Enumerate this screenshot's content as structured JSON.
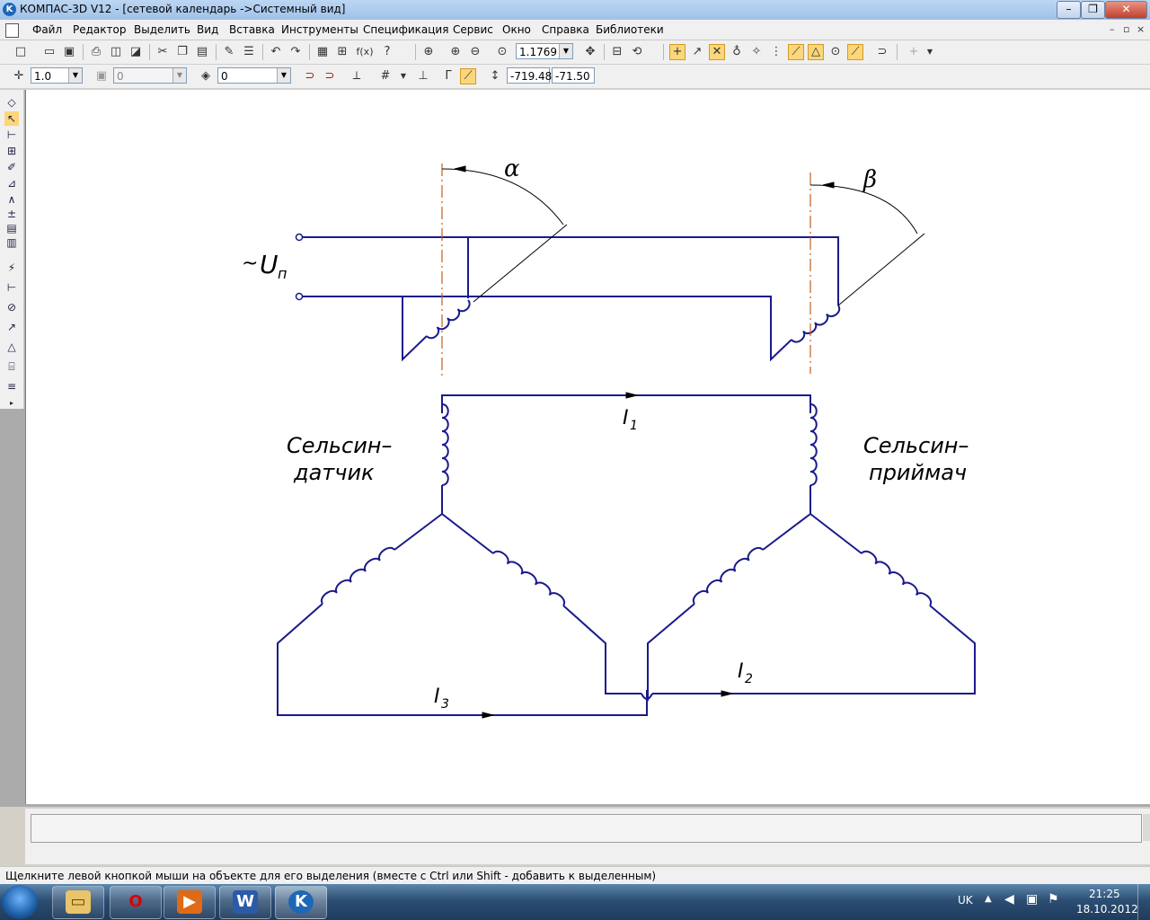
{
  "window": {
    "title": "КОМПАС-3D V12 - [сетевой календарь ->Системный вид]",
    "app_icon": "K",
    "minimize": "–",
    "restore": "❐",
    "close": "✕"
  },
  "menu": {
    "items": [
      "Файл",
      "Редактор",
      "Выделить",
      "Вид",
      "Вставка",
      "Инструменты",
      "Спецификация",
      "Сервис",
      "Окно",
      "Справка",
      "Библиотеки"
    ],
    "mdi_minimize": "–",
    "mdi_restore": "▫",
    "mdi_close": "×"
  },
  "toolbar1": {
    "zoom_value": "1.1769"
  },
  "toolbar2": {
    "step_value": "1.0",
    "layer_value": "0",
    "style_value": "0",
    "coord_x": "-719.48",
    "coord_y": "-71.50"
  },
  "drawing": {
    "line_color": "#1a1a8c",
    "axis_color": "#c06020",
    "alpha_label": "α",
    "beta_label": "β",
    "voltage_tilde": "~",
    "voltage_main": "U",
    "voltage_sub": "п",
    "sender_line1": "Сельсин–",
    "sender_line2": "датчик",
    "receiver_line1": "Сельсин–",
    "receiver_line2": "приймач",
    "i1_main": "I",
    "i1_sub": "1",
    "i2_main": "I",
    "i2_sub": "2",
    "i3_main": "I",
    "i3_sub": "3"
  },
  "status": {
    "message": "Щелкните левой кнопкой мыши на объекте для его выделения (вместе с Ctrl или Shift - добавить к выделенным)"
  },
  "taskbar": {
    "language": "UK",
    "time": "21:25",
    "date": "18.10.2012",
    "apps": [
      "explorer-icon",
      "opera-icon",
      "media-player-icon",
      "word-icon",
      "kompas-icon"
    ]
  }
}
